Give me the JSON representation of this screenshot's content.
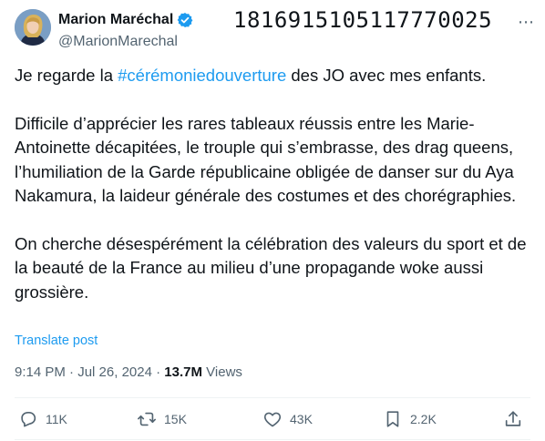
{
  "author": {
    "display_name": "Marion Maréchal",
    "handle": "@MarionMarechal",
    "verified": true
  },
  "post_id": "1816915105117770025",
  "body": {
    "p1_prefix": "Je regarde la ",
    "p1_hashtag": "#cérémoniedouverture",
    "p1_suffix": " des JO avec mes enfants.",
    "p2": "Difficile d’apprécier les rares tableaux réussis entre les Marie-Antoinette décapitées, le trouple qui s’embrasse, des drag queens, l’humiliation de la Garde républicaine obligée de danser sur du Aya Nakamura, la laideur générale des costumes et des chorégraphies.",
    "p3": "On cherche désespérément la célébration des valeurs du sport et de la beauté de la France au milieu d’une propagande woke aussi grossière."
  },
  "translate_label": "Translate post",
  "meta": {
    "time": "9:14 PM",
    "separator": " · ",
    "date": "Jul 26, 2024",
    "views_count": "13.7M",
    "views_label": " Views"
  },
  "actions": {
    "replies": "11K",
    "reposts": "15K",
    "likes": "43K",
    "bookmarks": "2.2K"
  },
  "colors": {
    "link": "#1d9bf0",
    "secondary_text": "#536471",
    "primary_text": "#0f1419",
    "verified_badge": "#1d9bf0",
    "divider": "#eff3f4"
  },
  "icons": [
    "avatar-photo",
    "verified-badge-icon",
    "more-icon",
    "reply-icon",
    "repost-icon",
    "like-icon",
    "bookmark-icon",
    "share-icon"
  ]
}
